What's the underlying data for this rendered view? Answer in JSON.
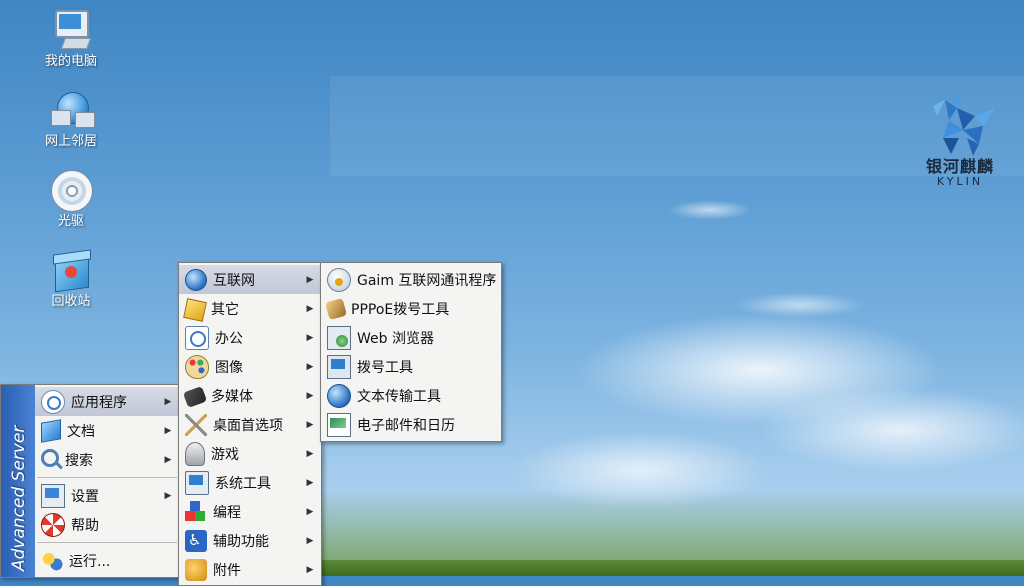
{
  "desktop": {
    "icons": [
      {
        "label": "我的电脑",
        "icon": "computer-icon"
      },
      {
        "label": "网上邻居",
        "icon": "network-icon"
      },
      {
        "label": "光驱",
        "icon": "cdrom-icon"
      },
      {
        "label": "回收站",
        "icon": "trash-icon"
      }
    ]
  },
  "logo": {
    "cn": "银河麒麟",
    "en": "KYLIN",
    "color": "#2b77c9"
  },
  "main_menu": {
    "side_label": "Advanced Server",
    "items": [
      {
        "label": "应用程序",
        "icon": "applications-icon",
        "arrow": "▶"
      },
      {
        "label": "文档",
        "icon": "documents-icon",
        "arrow": "▶"
      },
      {
        "label": "搜索",
        "icon": "search-icon",
        "arrow": "▶"
      },
      {
        "label": "设置",
        "icon": "settings-icon",
        "arrow": "▶"
      },
      {
        "label": "帮助",
        "icon": "help-icon"
      },
      {
        "label": "运行...",
        "icon": "run-icon"
      }
    ]
  },
  "apps_menu": {
    "items": [
      {
        "label": "互联网",
        "icon": "internet-icon",
        "arrow": "▶"
      },
      {
        "label": "其它",
        "icon": "other-icon",
        "arrow": "▶"
      },
      {
        "label": "办公",
        "icon": "office-icon",
        "arrow": "▶"
      },
      {
        "label": "图像",
        "icon": "graphics-icon",
        "arrow": "▶"
      },
      {
        "label": "多媒体",
        "icon": "multimedia-icon",
        "arrow": "▶"
      },
      {
        "label": "桌面首选项",
        "icon": "desktop-prefs-icon",
        "arrow": "▶"
      },
      {
        "label": "游戏",
        "icon": "games-icon",
        "arrow": "▶"
      },
      {
        "label": "系统工具",
        "icon": "system-tools-icon",
        "arrow": "▶"
      },
      {
        "label": "编程",
        "icon": "programming-icon",
        "arrow": "▶"
      },
      {
        "label": "辅助功能",
        "icon": "accessibility-icon",
        "arrow": "▶"
      },
      {
        "label": "附件",
        "icon": "accessories-icon",
        "arrow": "▶"
      }
    ]
  },
  "internet_menu": {
    "items": [
      {
        "label": "Gaim 互联网通讯程序",
        "icon": "gaim-icon"
      },
      {
        "label": "PPPoE拨号工具",
        "icon": "pppoe-icon"
      },
      {
        "label": "Web 浏览器",
        "icon": "web-browser-icon"
      },
      {
        "label": "拨号工具",
        "icon": "dialup-icon"
      },
      {
        "label": "文本传输工具",
        "icon": "file-transfer-icon"
      },
      {
        "label": "电子邮件和日历",
        "icon": "email-calendar-icon"
      }
    ]
  }
}
